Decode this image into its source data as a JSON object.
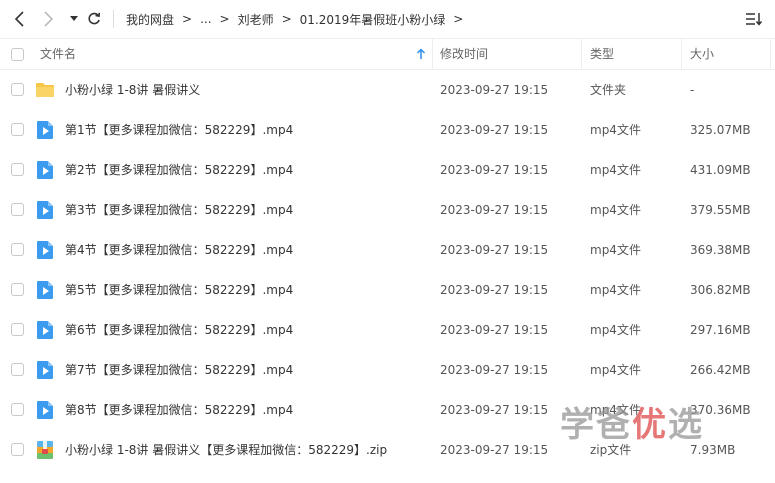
{
  "breadcrumb": [
    "我的网盘",
    "...",
    "刘老师",
    "01.2019年暑假班小粉小绿"
  ],
  "header": {
    "name": "文件名",
    "modified": "修改时间",
    "type": "类型",
    "size": "大小"
  },
  "files": [
    {
      "name": "小粉小绿 1-8讲 暑假讲义",
      "date": "2023-09-27 19:15",
      "type": "文件夹",
      "size": "-",
      "icon": "folder-icon"
    },
    {
      "name": "第1节【更多课程加微信：582229】.mp4",
      "date": "2023-09-27 19:15",
      "type": "mp4文件",
      "size": "325.07MB",
      "icon": "video-icon"
    },
    {
      "name": "第2节【更多课程加微信：582229】.mp4",
      "date": "2023-09-27 19:15",
      "type": "mp4文件",
      "size": "431.09MB",
      "icon": "video-icon"
    },
    {
      "name": "第3节【更多课程加微信：582229】.mp4",
      "date": "2023-09-27 19:15",
      "type": "mp4文件",
      "size": "379.55MB",
      "icon": "video-icon"
    },
    {
      "name": "第4节【更多课程加微信：582229】.mp4",
      "date": "2023-09-27 19:15",
      "type": "mp4文件",
      "size": "369.38MB",
      "icon": "video-icon"
    },
    {
      "name": "第5节【更多课程加微信：582229】.mp4",
      "date": "2023-09-27 19:15",
      "type": "mp4文件",
      "size": "306.82MB",
      "icon": "video-icon"
    },
    {
      "name": "第6节【更多课程加微信：582229】.mp4",
      "date": "2023-09-27 19:15",
      "type": "mp4文件",
      "size": "297.16MB",
      "icon": "video-icon"
    },
    {
      "name": "第7节【更多课程加微信：582229】.mp4",
      "date": "2023-09-27 19:15",
      "type": "mp4文件",
      "size": "266.42MB",
      "icon": "video-icon"
    },
    {
      "name": "第8节【更多课程加微信：582229】.mp4",
      "date": "2023-09-27 19:15",
      "type": "mp4文件",
      "size": "370.36MB",
      "icon": "video-icon"
    },
    {
      "name": "小粉小绿 1-8讲 暑假讲义【更多课程加微信：582229】.zip",
      "date": "2023-09-27 19:15",
      "type": "zip文件",
      "size": "7.93MB",
      "icon": "zip-icon"
    }
  ],
  "watermark": [
    "学",
    "爸",
    "优",
    "选"
  ],
  "colors": {
    "folder": "#F8C646",
    "video": "#3B9BF0",
    "accent": "#2F8EEB"
  }
}
